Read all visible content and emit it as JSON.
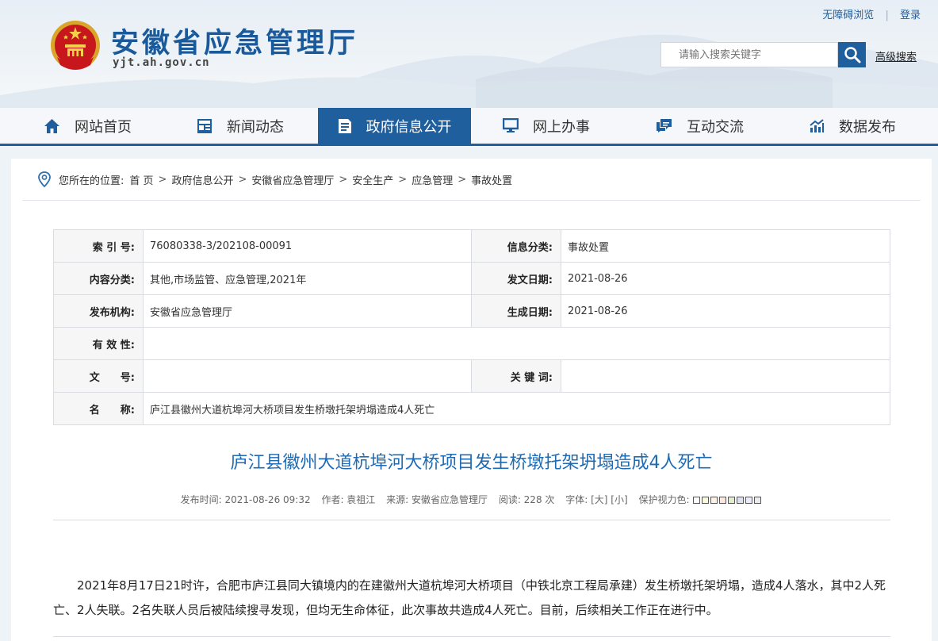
{
  "header": {
    "site_title": "安徽省应急管理厅",
    "site_domain": "yjt.ah.gov.cn",
    "accessible_link": "无障碍浏览",
    "login_link": "登录",
    "search_placeholder": "请输入搜索关键字",
    "advanced_search": "高级搜索"
  },
  "nav": [
    {
      "label": "网站首页",
      "icon": "home-icon"
    },
    {
      "label": "新闻动态",
      "icon": "news-icon"
    },
    {
      "label": "政府信息公开",
      "icon": "document-icon",
      "active": true
    },
    {
      "label": "网上办事",
      "icon": "monitor-icon"
    },
    {
      "label": "互动交流",
      "icon": "chat-icon"
    },
    {
      "label": "数据发布",
      "icon": "chart-icon"
    }
  ],
  "breadcrumb": {
    "prefix": "您所在的位置:",
    "items": [
      "首 页",
      "政府信息公开",
      "安徽省应急管理厅",
      "安全生产",
      "应急管理",
      "事故处置"
    ]
  },
  "info": {
    "index_label": "索 引 号:",
    "index_value": "76080338-3/202108-00091",
    "category_label": "信息分类:",
    "category_value": "事故处置",
    "content_cat_label": "内容分类:",
    "content_cat_value": "其他,市场监管、应急管理,2021年",
    "pub_date_label": "发文日期:",
    "pub_date_value": "2021-08-26",
    "publisher_label": "发布机构:",
    "publisher_value": "安徽省应急管理厅",
    "gen_date_label": "生成日期:",
    "gen_date_value": "2021-08-26",
    "validity_label": "有 效 性:",
    "validity_value": "",
    "doc_no_label": "文　　号:",
    "doc_no_value": "",
    "keywords_label": "关 键 词:",
    "keywords_value": "",
    "name_label": "名　　称:",
    "name_value": "庐江县徽州大道杭埠河大桥项目发生桥墩托架坍塌造成4人死亡"
  },
  "article": {
    "title": "庐江县徽州大道杭埠河大桥项目发生桥墩托架坍塌造成4人死亡",
    "meta": {
      "publish_time": "发布时间:  2021-08-26 09:32",
      "author": "作者:  袁祖江",
      "source": "来源:  安徽省应急管理厅",
      "views": "阅读:  228 次",
      "font_label": "字体:",
      "font_large": "[大]",
      "font_small": "[小]",
      "eye_label": "保护视力色:"
    },
    "paragraph": "2021年8月17日21时许，合肥市庐江县同大镇境内的在建徽州大道杭埠河大桥项目（中铁北京工程局承建）发生桥墩托架坍塌，造成4人落水，其中2人死亡、2人失联。2名失联人员后被陆续搜寻发现，但均无生命体征，此次事故共造成4人死亡。目前，后续相关工作正在进行中。"
  },
  "colors": {
    "brand_blue": "#1f5f9e",
    "title_blue": "#1f6bb3",
    "eye_swatches": [
      "#ffffff",
      "#faf9de",
      "#fff2e2",
      "#fde6e0",
      "#e3edcd",
      "#dce2f1",
      "#e9ebfe",
      "#eaeaef"
    ]
  }
}
